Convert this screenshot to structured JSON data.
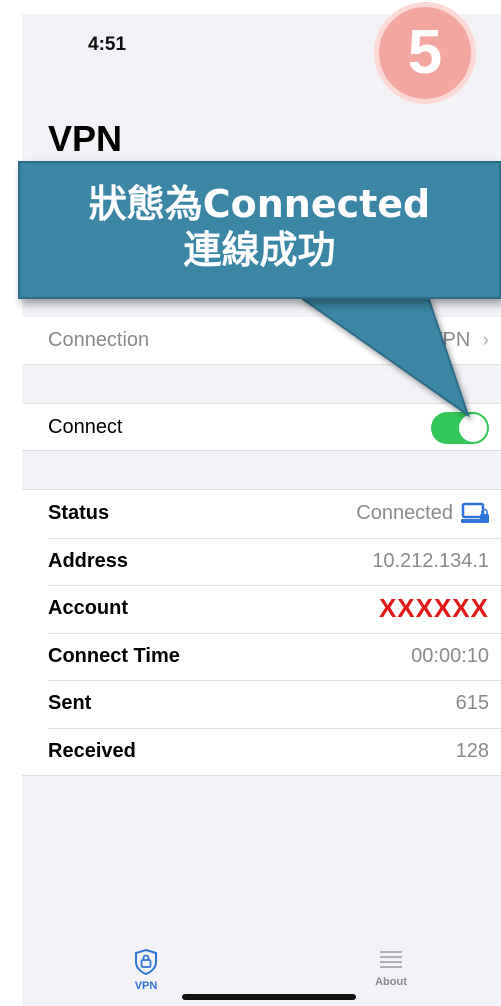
{
  "status_bar": {
    "time": "4:51"
  },
  "step_badge": "5",
  "page_title": "VPN",
  "callout": {
    "line1": "狀態為Connected",
    "line2": "連線成功"
  },
  "connection": {
    "label": "Connection",
    "value": "NPU VPN"
  },
  "connect_toggle": {
    "label": "Connect",
    "state": "on",
    "color": "#34c759"
  },
  "status_rows": [
    {
      "label": "Status",
      "value": "Connected"
    },
    {
      "label": "Address",
      "value": "10.212.134.1"
    },
    {
      "label": "Account",
      "value": "XXXXXX"
    },
    {
      "label": "Connect Time",
      "value": "00:00:10"
    },
    {
      "label": "Sent",
      "value": "615"
    },
    {
      "label": "Received",
      "value": "128"
    }
  ],
  "tabs": [
    {
      "label": "VPN",
      "icon": "lock-shield-icon",
      "active": true
    },
    {
      "label": "About",
      "icon": "list-icon",
      "active": false
    }
  ],
  "colors": {
    "accent": "#2f74d9",
    "callout": "#3b86a4",
    "badge": "#f4a6a1",
    "redacted": "#e31818"
  }
}
